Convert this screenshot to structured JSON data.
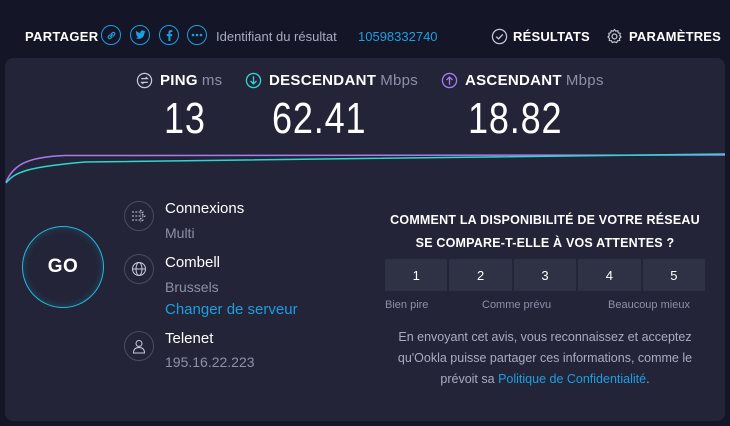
{
  "header": {
    "share_label": "PARTAGER",
    "share_buttons": [
      {
        "icon": "link-icon"
      },
      {
        "icon": "twitter-icon"
      },
      {
        "icon": "facebook-icon"
      },
      {
        "icon": "more-icon"
      }
    ],
    "result_id_label": "Identifiant du résultat",
    "result_id_value": "10598332740",
    "results_label": "RÉSULTATS",
    "settings_label": "PARAMÈTRES"
  },
  "metrics": {
    "ping": {
      "label": "PING",
      "unit": "ms",
      "value": "13"
    },
    "download": {
      "label": "DESCENDANT",
      "unit": "Mbps",
      "value": "62.41"
    },
    "upload": {
      "label": "ASCENDANT",
      "unit": "Mbps",
      "value": "18.82"
    }
  },
  "go_label": "GO",
  "connections": {
    "title": "Connexions",
    "value": "Multi"
  },
  "server": {
    "name": "Combell",
    "location": "Brussels",
    "change_link": "Changer de serveur"
  },
  "provider": {
    "name": "Telenet",
    "ip": "195.16.22.223"
  },
  "survey": {
    "question_line1": "COMMENT LA DISPONIBILITÉ DE VOTRE RÉSEAU",
    "question_line2": "SE COMPARE-T-ELLE À VOS ATTENTES ?",
    "ratings": [
      "1",
      "2",
      "3",
      "4",
      "5"
    ],
    "low_label": "Bien pire",
    "mid_label": "Comme prévu",
    "high_label": "Beaucoup mieux",
    "disclaimer_text": "En envoyant cet avis, vous reconnaissez et acceptez qu'Ookla puisse partager ces informations, comme le prévoit sa",
    "policy_link": "Politique de Confidentialité",
    "disclaimer_end": "."
  },
  "colors": {
    "background": "#141526",
    "panel": "#232438",
    "accent": "#1c9fe0",
    "download_line": "#2fd6d0",
    "upload_line": "#a77bf0"
  }
}
